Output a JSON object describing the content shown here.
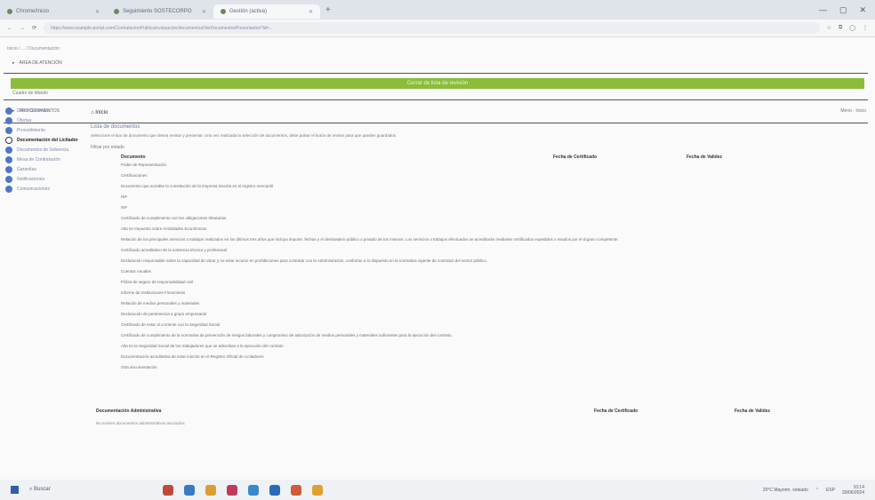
{
  "browser": {
    "tabs": [
      {
        "label": "Chrome/Inicio"
      },
      {
        "label": "Seguimiento SOSTECORPO"
      },
      {
        "label": "Gestión (activa)"
      }
    ],
    "url": "https://www.example-portal.com/ContratacionPublica/evaluacion/documentos/VerDocumentosPresentados?id=..."
  },
  "page": {
    "breadcrumb": "Inicio / ... / Documentación",
    "section1": "ÁREA DE ATENCIÓN",
    "green_banner": "Cerrar de lista de revisión",
    "subnote": "Cuadro de Mando",
    "section2": "PROCEDIMIENTOS",
    "home_label": "Inicio",
    "top_right": "Menú · Inicio",
    "list_title": "Lista de documentos",
    "intro": "Seleccione el tipo de documento que desea revisar y presentar. Una vez realizada la selección de documentos, debe pulsar el botón de revisar para que queden guardados.",
    "filter_label": "Filtrar por estado",
    "columns": {
      "document": "Documento",
      "date_certificate": "Fecha de Certificado",
      "date_validity": "Fecha de Validez"
    },
    "documents": [
      "Poder de Representación",
      "Certificaciones",
      "Documento que acredite la constitución de la empresa inscrita en el registro mercantil",
      "NIF",
      "NIF",
      "Certificado de cumplimiento con las obligaciones tributarias",
      "Alta en Impuesto sobre Actividades Económicas",
      "Relación de los principales servicios o trabajos realizados en los últimos tres años que incluya importe, fechas y el destinatario público o privado de los mismos. Los servicios o trabajos efectuados se acreditarán mediante certificados expedidos o visados por el órgano competente.",
      "Certificado acreditativo de la solvencia técnica y profesional",
      "Declaración responsable sobre la capacidad de obrar y no estar incurso en prohibiciones para contratar con la Administración, conforme a lo dispuesto en la normativa vigente de contratos del sector público.",
      "Cuentas Anuales",
      "Póliza de seguro de responsabilidad civil",
      "Informe de Instituciones Financieras",
      "Relación de medios personales y materiales",
      "Declaración de pertenencia a grupo empresarial",
      "Certificado de estar al corriente con la Seguridad Social",
      "Certificado de cumplimiento de la normativa de prevención de riesgos laborales y compromiso de adscripción de medios personales y materiales suficientes para la ejecución del contrato.",
      "Alta en la Seguridad Social de los trabajadores que se adscriban a la ejecución del contrato",
      "Documentación acreditativa de estar inscrito en el Registro Oficial de Licitadores",
      "Otra documentación"
    ],
    "footer": {
      "col1": "Documentación Administrativa",
      "col2": "Fecha de Certificado",
      "col3": "Fecha de Validez",
      "note": "No existen documentos administrativos asociados"
    }
  },
  "sidebar": {
    "items": [
      {
        "label": "Datos Generales"
      },
      {
        "label": "Ofertas"
      },
      {
        "label": "Procedimiento"
      },
      {
        "label": "Documentación del Licitador"
      },
      {
        "label": "Documentos de Solvencia"
      },
      {
        "label": "Mesa de Contratación"
      },
      {
        "label": "Garantías"
      },
      {
        "label": "Notificaciones"
      },
      {
        "label": "Comunicaciones"
      }
    ]
  },
  "taskbar": {
    "search": "Buscar",
    "weather": "20°C Mayorm. soleado",
    "lang": "ESP",
    "time": "10:14",
    "date": "20/06/2024"
  }
}
